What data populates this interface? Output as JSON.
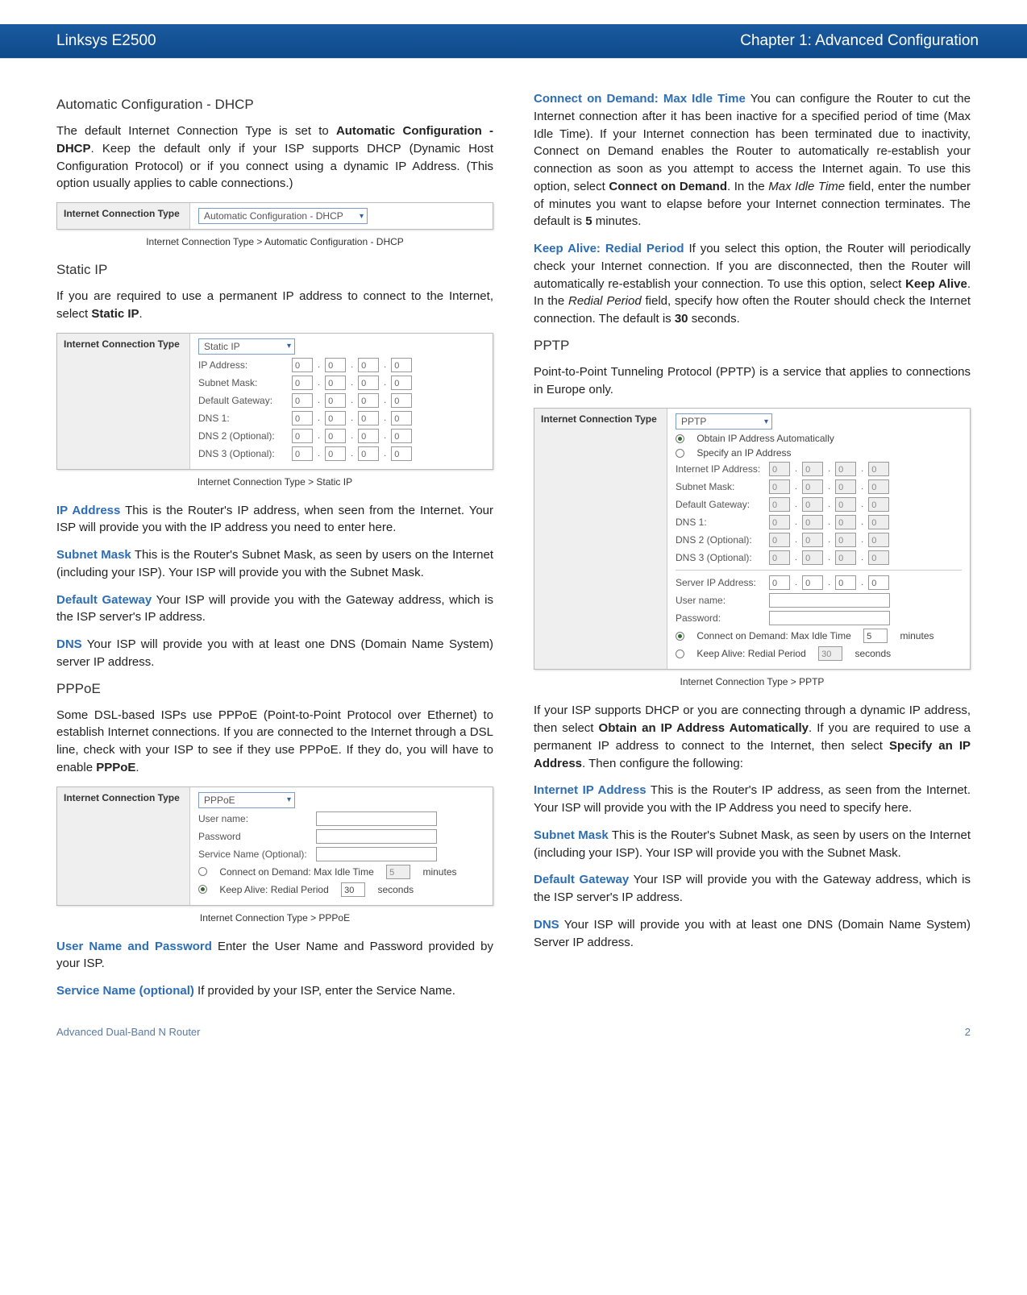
{
  "header": {
    "product": "Linksys E2500",
    "chapter": "Chapter 1: Advanced Configuration"
  },
  "footer": {
    "left": "Advanced Dual-Band N Router",
    "right": "2"
  },
  "left": {
    "dhcp": {
      "heading": "Automatic Configuration - DHCP",
      "p1a": "The default Internet Connection Type is set to ",
      "p1b": "Automatic Configuration - DHCP",
      "p1c": ". Keep the default only if your ISP supports DHCP (Dynamic Host Configuration Protocol) or if you connect using a dynamic IP Address. (This option usually applies to cable connections.)",
      "fig_label": "Internet Connection Type",
      "fig_value": "Automatic Configuration - DHCP",
      "caption": "Internet Connection Type > Automatic Configuration - DHCP"
    },
    "staticip": {
      "heading": "Static IP",
      "p1a": "If you are required to use a permanent IP address to connect to the Internet, select ",
      "p1b": "Static IP",
      "p1c": ".",
      "fig_label": "Internet Connection Type",
      "fig_value": "Static IP",
      "rows": {
        "ip": "IP Address:",
        "mask": "Subnet Mask:",
        "gw": "Default Gateway:",
        "dns1": "DNS 1:",
        "dns2": "DNS 2 (Optional):",
        "dns3": "DNS 3 (Optional):"
      },
      "oct": "0",
      "caption": "Internet Connection Type > Static IP",
      "ip_term": "IP Address",
      "ip_body": "  This is the Router's IP address, when seen from the Internet. Your ISP will provide you with the IP address you need to enter here.",
      "mask_term": "Subnet Mask",
      "mask_body": "  This is the Router's Subnet Mask, as seen by users on the Internet (including your ISP). Your ISP will provide you with the Subnet Mask.",
      "gw_term": "Default Gateway",
      "gw_body": "  Your ISP will provide you with the Gateway address, which is the ISP server's IP address.",
      "dns_term": "DNS",
      "dns_body": "  Your ISP will provide you with at least one DNS (Domain Name System) server IP address."
    },
    "pppoe": {
      "heading": "PPPoE",
      "p1a": "Some DSL-based ISPs use PPPoE (Point-to-Point Protocol over Ethernet) to establish Internet connections. If you are connected to the Internet through a DSL line, check with your ISP to see if they use PPPoE. If they do, you will have to enable ",
      "p1b": "PPPoE",
      "p1c": ".",
      "fig_label": "Internet Connection Type",
      "fig_value": "PPPoE",
      "user": "User name:",
      "pass": "Password",
      "svc": "Service Name (Optional):",
      "cod": "Connect on Demand: Max Idle Time",
      "cod_val": "5",
      "cod_unit": "minutes",
      "ka": "Keep Alive: Redial Period",
      "ka_val": "30",
      "ka_unit": "seconds",
      "caption": "Internet Connection Type > PPPoE",
      "up_term": "User Name and Password",
      "up_body": "  Enter the User Name and Password provided by your ISP.",
      "sn_term": "Service Name (optional)",
      "sn_body": "  If provided by your ISP, enter the Service Name."
    }
  },
  "right": {
    "cod_term": "Connect on Demand: Max Idle Time",
    "cod_body_a": "  You can configure the Router to cut the Internet connection after it has been inactive for a specified period of time (Max Idle Time). If your Internet connection has been terminated due to inactivity, Connect on Demand enables the Router to automatically re-establish your connection as soon as you attempt to access the Internet again. To use this option, select ",
    "cod_body_b": "Connect on Demand",
    "cod_body_c": ". In the ",
    "cod_body_d": "Max Idle Time",
    "cod_body_e": " field, enter the number of minutes you want to elapse before your Internet connection terminates. The default is ",
    "cod_body_f": "5",
    "cod_body_g": " minutes.",
    "ka_term": "Keep Alive: Redial Period",
    "ka_body_a": "  If you select this option, the Router will periodically check your Internet connection. If you are disconnected, then the Router will automatically re-establish your connection. To use this option, select ",
    "ka_body_b": "Keep Alive",
    "ka_body_c": ". In the ",
    "ka_body_d": "Redial Period",
    "ka_body_e": " field, specify how often the Router should check the Internet connection. The default is ",
    "ka_body_f": "30",
    "ka_body_g": " seconds.",
    "pptp": {
      "heading": "PPTP",
      "p1": "Point-to-Point Tunneling Protocol (PPTP) is a service that applies to connections in Europe only.",
      "fig_label": "Internet Connection Type",
      "fig_value": "PPTP",
      "auto": "Obtain IP Address Automatically",
      "spec": "Specify an IP Address",
      "rows": {
        "ip": "Internet IP Address:",
        "mask": "Subnet Mask:",
        "gw": "Default Gateway:",
        "dns1": "DNS 1:",
        "dns2": "DNS 2 (Optional):",
        "dns3": "DNS 3 (Optional):",
        "server": "Server IP Address:",
        "user": "User name:",
        "pass": "Password:"
      },
      "oct_gray": "0",
      "oct": "0",
      "cod": "Connect on Demand: Max Idle Time",
      "cod_val": "5",
      "cod_unit": "minutes",
      "ka": "Keep Alive: Redial Period",
      "ka_val": "30",
      "ka_unit": "seconds",
      "caption": "Internet Connection Type > PPTP",
      "p2a": "If your ISP supports DHCP or you are connecting through a dynamic IP address, then select ",
      "p2b": "Obtain an IP Address Automatically",
      "p2c": ". If you are required to use a permanent IP address to connect to the Internet, then select ",
      "p2d": "Specify an IP Address",
      "p2e": ". Then configure the following:",
      "ip_term": "Internet IP Address",
      "ip_body": "  This is the Router's IP address, as seen from the Internet. Your ISP will provide you with the IP Address you need to specify here.",
      "mask_term": "Subnet Mask",
      "mask_body": "  This is the Router's Subnet Mask, as seen by users on the Internet (including your ISP). Your ISP will provide you with the Subnet Mask.",
      "gw_term": "Default Gateway",
      "gw_body": "  Your ISP will provide you with the Gateway address, which is the ISP server's IP address.",
      "dns_term": "DNS",
      "dns_body": "  Your ISP will provide you with at least one DNS (Domain Name System) Server IP address."
    }
  }
}
